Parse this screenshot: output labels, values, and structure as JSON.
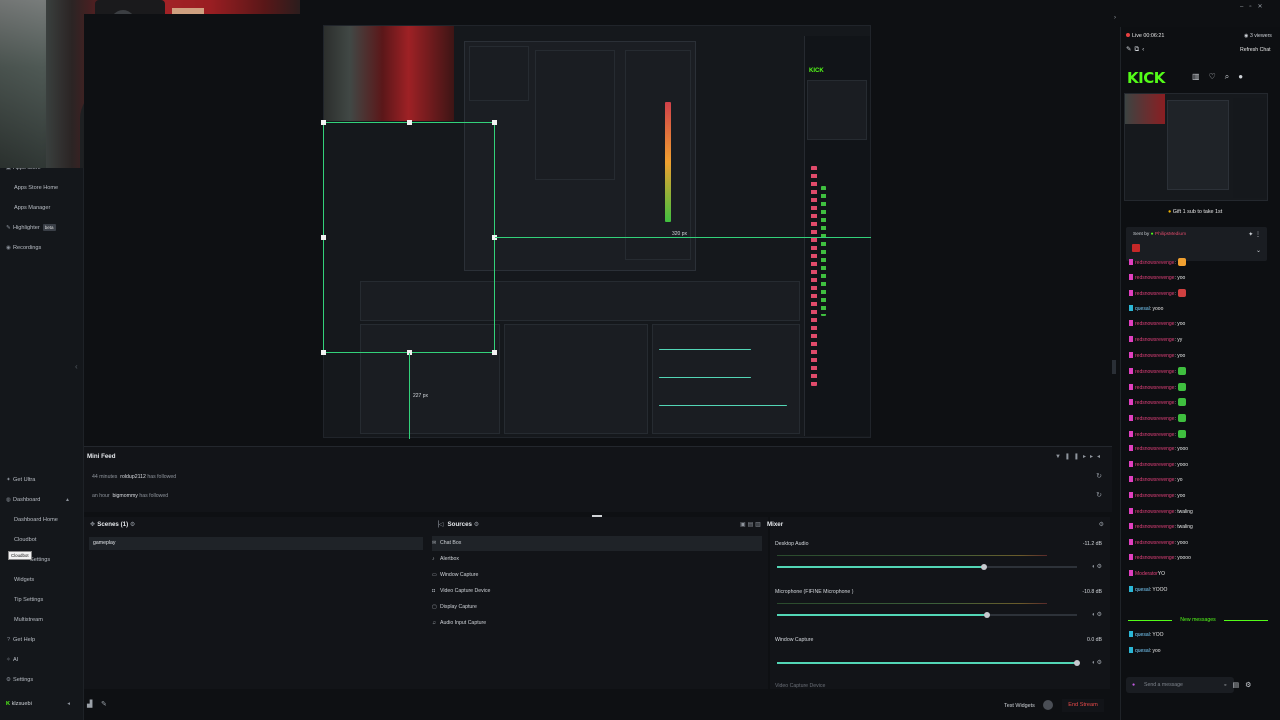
{
  "sidebar": {
    "items": [
      {
        "label": "Apps Store",
        "icon": "store-icon"
      },
      {
        "label": "Apps Store Home",
        "icon": ""
      },
      {
        "label": "Apps Manager",
        "icon": ""
      },
      {
        "label": "Highlighter",
        "icon": "highlighter-icon",
        "badge": "beta"
      },
      {
        "label": "Recordings",
        "icon": "recordings-icon"
      }
    ],
    "lower_items": [
      {
        "label": "Get Ultra",
        "icon": "ultra-icon"
      },
      {
        "label": "Dashboard",
        "icon": "dashboard-icon"
      },
      {
        "label": "Dashboard Home",
        "icon": ""
      },
      {
        "label": "Cloudbot",
        "icon": ""
      },
      {
        "label": "Settings",
        "icon": ""
      },
      {
        "label": "Widgets",
        "icon": ""
      },
      {
        "label": "Tip Settings",
        "icon": ""
      },
      {
        "label": "Multistream",
        "icon": ""
      },
      {
        "label": "Get Help",
        "icon": "help-icon"
      },
      {
        "label": "AI",
        "icon": "ai-icon"
      },
      {
        "label": "Settings",
        "icon": "gear-icon"
      }
    ],
    "tooltip": "Cloudbot",
    "user": "klzsuebi"
  },
  "canvas": {
    "height_label": "227 px",
    "width_label": "320 px"
  },
  "minifeed": {
    "title": "Mini Feed",
    "rows": [
      {
        "time": "44 minutes",
        "user": "roldup2112",
        "action": "has followed"
      },
      {
        "time": "an hour",
        "user": "bigmommy",
        "action": "has followed"
      }
    ]
  },
  "scenes": {
    "title": "Scenes (1)",
    "items": [
      "gameplay"
    ]
  },
  "sources": {
    "title": "Sources",
    "items": [
      {
        "label": "Chat Box",
        "icon": "chat-icon"
      },
      {
        "label": "Alertbox",
        "icon": "alert-icon"
      },
      {
        "label": "Window Capture",
        "icon": "window-icon"
      },
      {
        "label": "Video Capture Device",
        "icon": "camera-icon"
      },
      {
        "label": "Display Capture",
        "icon": "display-icon"
      },
      {
        "label": "Audio Input Capture",
        "icon": "mic-icon"
      }
    ]
  },
  "mixer": {
    "title": "Mixer",
    "channels": [
      {
        "label": "Desktop Audio",
        "db": "-11.2 dB",
        "level": 0.69
      },
      {
        "label": "Microphone (FIFINE Microphone )",
        "db": "-10.8 dB",
        "level": 0.7
      },
      {
        "label": "Window Capture",
        "db": "0.0 dB",
        "level": 1.0
      }
    ],
    "truncated_label": "Video Capture Device"
  },
  "bottombar": {
    "test_widgets": "Test Widgets",
    "end_stream": "End Stream"
  },
  "chat": {
    "live": "Live 00:06:21",
    "viewers": "3 viewers",
    "refresh": "Refresh Chat",
    "brand": "KICK",
    "gift_text": "Gift 1 sub to take 1st",
    "sent_by": "Sent by",
    "sent_by_user": "PhilipsMedium",
    "messages": [
      {
        "user": "redsnowsrevenge",
        "text": ":",
        "emote": "o"
      },
      {
        "user": "redsnowsrevenge",
        "text": ": yoo",
        "emote": ""
      },
      {
        "user": "redsnowsrevenge",
        "text": ":",
        "emote": "r"
      },
      {
        "user": "quesal",
        "text": ": yooo",
        "emote": "",
        "cyan": true
      },
      {
        "user": "redsnowsrevenge",
        "text": ": yoo",
        "emote": ""
      },
      {
        "user": "redsnowsrevenge",
        "text": ": yy",
        "emote": ""
      },
      {
        "user": "redsnowsrevenge",
        "text": ": yoo",
        "emote": ""
      },
      {
        "user": "redsnowsrevenge",
        "text": ":",
        "emote": "g"
      },
      {
        "user": "redsnowsrevenge",
        "text": ":",
        "emote": "g"
      },
      {
        "user": "redsnowsrevenge",
        "text": ":",
        "emote": "g"
      },
      {
        "user": "redsnowsrevenge",
        "text": ":",
        "emote": "g"
      },
      {
        "user": "redsnowsrevenge",
        "text": ":",
        "emote": "g"
      },
      {
        "user": "redsnowsrevenge",
        "text": ": yooo",
        "emote": ""
      },
      {
        "user": "redsnowsrevenge",
        "text": ": yooo",
        "emote": ""
      },
      {
        "user": "redsnowsrevenge",
        "text": ": yo",
        "emote": ""
      },
      {
        "user": "redsnowsrevenge",
        "text": ": yoo",
        "emote": ""
      },
      {
        "user": "redsnowsrevenge",
        "text": ": twaling",
        "emote": ""
      },
      {
        "user": "redsnowsrevenge",
        "text": ": twaling",
        "emote": ""
      },
      {
        "user": "redsnowsrevenge",
        "text": ": yooo",
        "emote": ""
      },
      {
        "user": "redsnowsrevenge",
        "text": ": yoooo",
        "emote": ""
      },
      {
        "user": "Moderator",
        "text": "YO",
        "emote": ""
      },
      {
        "user": "quesal",
        "text": ": YOOO",
        "emote": "",
        "cyan": true
      }
    ],
    "new_messages": "New messages",
    "after": [
      {
        "user": "quesal",
        "text": ": YOO"
      },
      {
        "user": "quesal",
        "text": ": yoo"
      }
    ],
    "placeholder": "Send a message"
  }
}
